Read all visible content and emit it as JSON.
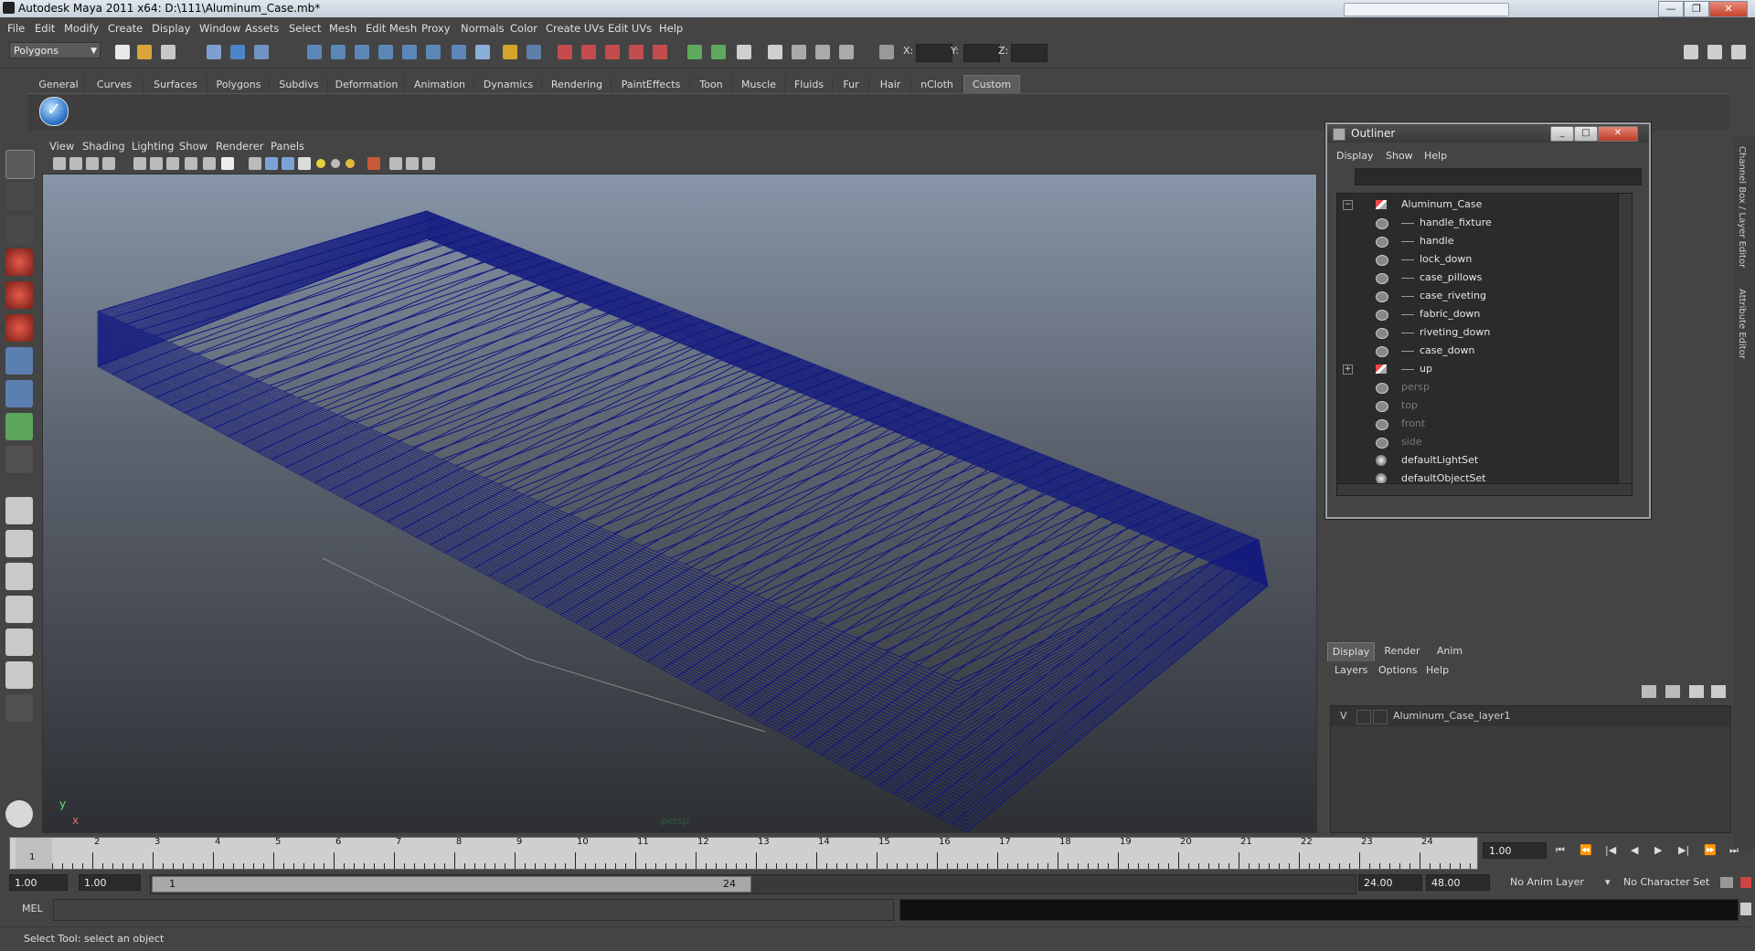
{
  "window": {
    "title": "Autodesk Maya 2011 x64: D:\\111\\Aluminum_Case.mb*"
  },
  "menubar": [
    "File",
    "Edit",
    "Modify",
    "Create",
    "Display",
    "Window",
    "Assets",
    "Select",
    "Mesh",
    "Edit Mesh",
    "Proxy",
    "Normals",
    "Color",
    "Create UVs",
    "Edit UVs",
    "Help"
  ],
  "status": {
    "mode": "Polygons",
    "x_label": "X:",
    "y_label": "Y:",
    "z_label": "Z:"
  },
  "shelf": {
    "tabs": [
      "General",
      "Curves",
      "Surfaces",
      "Polygons",
      "Subdivs",
      "Deformation",
      "Animation",
      "Dynamics",
      "Rendering",
      "PaintEffects",
      "Toon",
      "Muscle",
      "Fluids",
      "Fur",
      "Hair",
      "nCloth",
      "Custom"
    ],
    "active": "Custom"
  },
  "viewport": {
    "menu": [
      "View",
      "Shading",
      "Lighting",
      "Show",
      "Renderer",
      "Panels"
    ],
    "camera": "persp",
    "axis_y": "y",
    "axis_x": "x",
    "wire_color": "#0f1680"
  },
  "outliner": {
    "title": "Outliner",
    "menu": [
      "Display",
      "Show",
      "Help"
    ],
    "items": [
      {
        "label": "Aluminum_Case",
        "icon": "transform-icon",
        "level": 0,
        "expand": "−"
      },
      {
        "label": "handle_fixture",
        "icon": "mesh-icon",
        "level": 1
      },
      {
        "label": "handle",
        "icon": "mesh-icon",
        "level": 1
      },
      {
        "label": "lock_down",
        "icon": "mesh-icon",
        "level": 1
      },
      {
        "label": "case_pillows",
        "icon": "mesh-icon",
        "level": 1
      },
      {
        "label": "case_riveting",
        "icon": "mesh-icon",
        "level": 1
      },
      {
        "label": "fabric_down",
        "icon": "mesh-icon",
        "level": 1
      },
      {
        "label": "riveting_down",
        "icon": "mesh-icon",
        "level": 1
      },
      {
        "label": "case_down",
        "icon": "mesh-icon",
        "level": 1
      },
      {
        "label": "up",
        "icon": "transform-icon",
        "level": 1,
        "expand": "+"
      },
      {
        "label": "persp",
        "icon": "camera-icon",
        "level": 0,
        "dim": true
      },
      {
        "label": "top",
        "icon": "camera-icon",
        "level": 0,
        "dim": true
      },
      {
        "label": "front",
        "icon": "camera-icon",
        "level": 0,
        "dim": true
      },
      {
        "label": "side",
        "icon": "camera-icon",
        "level": 0,
        "dim": true
      },
      {
        "label": "defaultLightSet",
        "icon": "set-icon",
        "level": 0
      },
      {
        "label": "defaultObjectSet",
        "icon": "set-icon",
        "level": 0
      }
    ]
  },
  "layers": {
    "tabs": [
      "Display",
      "Render",
      "Anim"
    ],
    "active": "Display",
    "menu": [
      "Layers",
      "Options",
      "Help"
    ],
    "rows": [
      {
        "visible": "V",
        "name": "Aluminum_Case_layer1"
      }
    ]
  },
  "side_tabs": [
    "Channel Box / Layer Editor",
    "Attribute Editor"
  ],
  "timeline": {
    "ticks": [
      1,
      2,
      3,
      4,
      5,
      6,
      7,
      8,
      9,
      10,
      11,
      12,
      13,
      14,
      15,
      16,
      17,
      18,
      19,
      20,
      21,
      22,
      23,
      24
    ],
    "current_frame_marker": "1",
    "current_frame": "1.00"
  },
  "range": {
    "start": "1.00",
    "playback_start": "1.00",
    "bar_start": "1",
    "bar_end": "24",
    "playback_end": "24.00",
    "end": "48.00",
    "anim_layer": "No Anim Layer",
    "char_set": "No Character Set"
  },
  "command": {
    "mel_label": "MEL"
  },
  "helpline": {
    "text": "Select Tool: select an object"
  }
}
